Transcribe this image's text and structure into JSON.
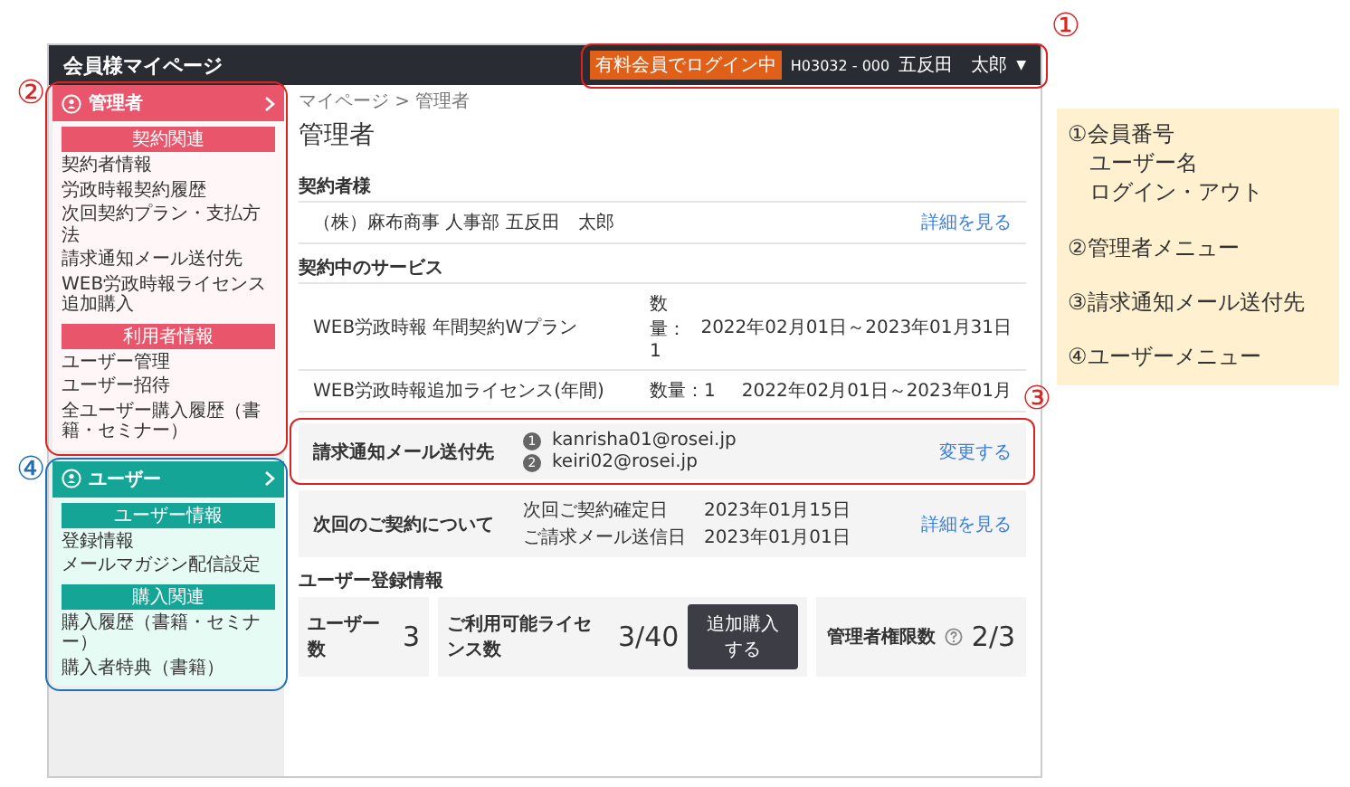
{
  "header": {
    "title": "会員様マイページ",
    "login_badge": "有料会員でログイン中",
    "member_number": "H03032 - 000",
    "user_name": "五反田　太郎",
    "menu_caret": "▼",
    "callout": "①"
  },
  "sidebar": [
    {
      "kind": "admin",
      "title": "管理者",
      "callout": "②",
      "groups": [
        {
          "heading": "契約関連",
          "items": [
            "契約者情報",
            "労政時報契約履歴",
            "次回契約プラン・支払方法",
            "請求通知メール送付先",
            "WEB労政時報ライセンス追加購入"
          ]
        },
        {
          "heading": "利用者情報",
          "items": [
            "ユーザー管理",
            "ユーザー招待",
            "全ユーザー購入履歴（書籍・セミナー）"
          ]
        }
      ]
    },
    {
      "kind": "user",
      "title": "ユーザー",
      "callout": "④",
      "groups": [
        {
          "heading": "ユーザー情報",
          "items": [
            "登録情報",
            "メールマガジン配信設定"
          ]
        },
        {
          "heading": "購入関連",
          "items": [
            "購入履歴（書籍・セミナー）",
            "購入者特典（書籍）"
          ]
        }
      ]
    }
  ],
  "main": {
    "breadcrumb": "マイページ > 管理者",
    "title": "管理者",
    "contractor": {
      "heading": "契約者様",
      "name": "（株）麻布商事 人事部 五反田　太郎",
      "link": "詳細を見る"
    },
    "services": {
      "heading": "契約中のサービス",
      "rows": [
        {
          "name": "WEB労政時報 年間契約Wプラン",
          "quantity": "数量：1",
          "period": "2022年02月01日～2023年01月31日"
        },
        {
          "name": "WEB労政時報追加ライセンス(年間)",
          "quantity": "数量：1",
          "period": "2022年02月01日～2023年01月"
        }
      ]
    },
    "billing": {
      "label": "請求通知メール送付先",
      "emails": [
        {
          "number": "1",
          "address": "kanrisha01@rosei.jp"
        },
        {
          "number": "2",
          "address": "keiri02@rosei.jp"
        }
      ],
      "link": "変更する",
      "callout": "③"
    },
    "next_contract": {
      "label": "次回のご契約について",
      "rows": [
        {
          "term": "次回ご契約確定日",
          "date": "2023年01月15日"
        },
        {
          "term": "ご請求メール送信日",
          "date": "2023年01月01日"
        }
      ],
      "link": "詳細を見る"
    },
    "user_registration": {
      "heading": "ユーザー登録情報",
      "stats": [
        {
          "kind": "plain",
          "label": "ユーザー数",
          "value": "3"
        },
        {
          "kind": "button",
          "label": "ご利用可能ライセンス数",
          "value": "3/40",
          "button": "追加購入する"
        },
        {
          "kind": "help",
          "label": "管理者権限数",
          "value": "2/3"
        }
      ]
    }
  },
  "notes": [
    {
      "lines": [
        "①会員番号",
        "ユーザー名",
        "ログイン・アウト"
      ]
    },
    {
      "lines": [
        "②管理者メニュー"
      ]
    },
    {
      "lines": [
        "③請求通知メール送付先"
      ]
    },
    {
      "lines": [
        "④ユーザーメニュー"
      ]
    }
  ]
}
